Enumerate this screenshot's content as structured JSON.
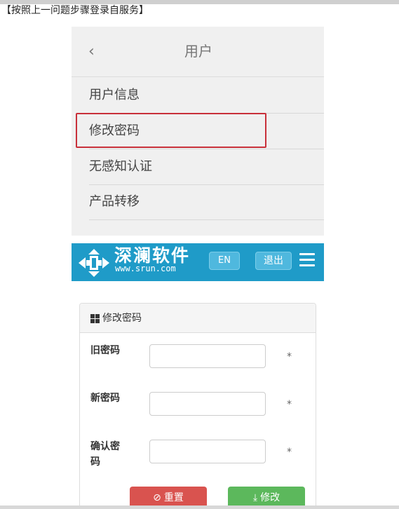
{
  "caption": "【按照上一问题步骤登录自服务】",
  "menu": {
    "back_icon": "chevron-left-icon",
    "title": "用户",
    "items": [
      {
        "label": "用户信息"
      },
      {
        "label": "修改密码"
      },
      {
        "label": "无感知认证"
      },
      {
        "label": "产品转移"
      }
    ],
    "highlight_color": "#c8303a"
  },
  "brand": {
    "name": "深澜软件",
    "url": "www.srun.com",
    "en_button": "EN",
    "logout_button": "退出",
    "menu_icon": "hamburger-icon",
    "bar_color": "#1f9bc8"
  },
  "form": {
    "title": "修改密码",
    "title_icon": "grid-icon",
    "fields": [
      {
        "label": "旧密码",
        "value": "",
        "required_mark": "*"
      },
      {
        "label": "新密码",
        "value": "",
        "required_mark": "*"
      },
      {
        "label": "确认密码",
        "value": "",
        "required_mark": "*"
      }
    ],
    "reset_button": "重置",
    "reset_icon": "ban-icon",
    "submit_button": "修改",
    "submit_icon": "download-icon",
    "reset_color": "#d9534f",
    "submit_color": "#5cb85c"
  }
}
